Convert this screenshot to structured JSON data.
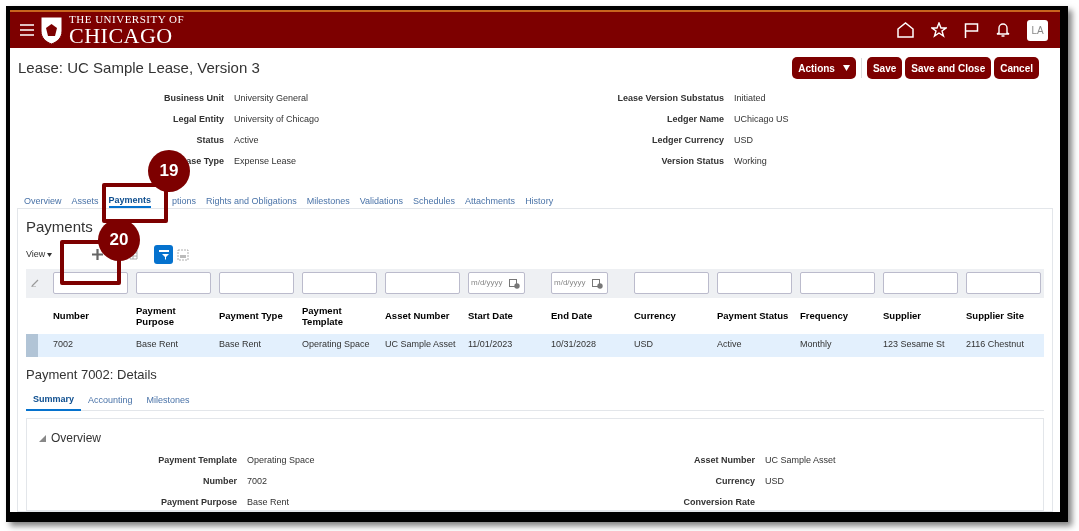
{
  "header": {
    "logo_top": "THE UNIVERSITY OF",
    "logo_bottom": "CHICAGO",
    "avatar": "LA"
  },
  "page_title": "Lease: UC Sample Lease, Version 3",
  "buttons": [
    {
      "label": "Actions",
      "kind": "menu"
    },
    {
      "label": "Save",
      "kind": "plain"
    },
    {
      "label": "Save and Close",
      "kind": "plain"
    },
    {
      "label": "Cancel",
      "kind": "plain"
    }
  ],
  "lease_fields_left": [
    {
      "label": "Business Unit",
      "value": "University General"
    },
    {
      "label": "Legal Entity",
      "value": "University of Chicago"
    },
    {
      "label": "Status",
      "value": "Active"
    },
    {
      "label": "ase Type",
      "value": "Expense Lease"
    }
  ],
  "lease_fields_right": [
    {
      "label": "Lease Version Substatus",
      "value": "Initiated"
    },
    {
      "label": "Ledger Name",
      "value": "UChicago US"
    },
    {
      "label": "Ledger Currency",
      "value": "USD"
    },
    {
      "label": "Version Status",
      "value": "Working"
    }
  ],
  "tabs": [
    {
      "label": "Overview",
      "selected": false
    },
    {
      "label": "Assets",
      "selected": false
    },
    {
      "label": "Payments",
      "selected": true
    },
    {
      "label": "ptions",
      "selected": false
    },
    {
      "label": "Rights and Obligations",
      "selected": false
    },
    {
      "label": "Milestones",
      "selected": false
    },
    {
      "label": "Validations",
      "selected": false
    },
    {
      "label": "Schedules",
      "selected": false
    },
    {
      "label": "Attachments",
      "selected": false
    },
    {
      "label": "History",
      "selected": false
    }
  ],
  "payments": {
    "title": "Payments",
    "view_menu": "View",
    "filters": [
      {
        "kind": "text"
      },
      {
        "kind": "text"
      },
      {
        "kind": "text"
      },
      {
        "kind": "text"
      },
      {
        "kind": "text"
      },
      {
        "kind": "date",
        "placeholder": "m/d/yyyy"
      },
      {
        "kind": "date",
        "placeholder": "m/d/yyyy"
      },
      {
        "kind": "text"
      },
      {
        "kind": "text"
      },
      {
        "kind": "text"
      },
      {
        "kind": "text"
      },
      {
        "kind": "text"
      }
    ],
    "columns": [
      "Number",
      "Payment Purpose",
      "Payment Type",
      "Payment Template",
      "Asset Number",
      "Start Date",
      "End Date",
      "Currency",
      "Payment Status",
      "Frequency",
      "Supplier",
      "Supplier Site"
    ],
    "rows": [
      {
        "selected": true,
        "cells": [
          "7002",
          "Base Rent",
          "Base Rent",
          "Operating Space",
          "UC Sample Asset",
          "11/01/2023",
          "10/31/2028",
          "USD",
          "Active",
          "Monthly",
          "123 Sesame St",
          "2116 Chestnut"
        ]
      }
    ]
  },
  "details": {
    "title": "Payment 7002: Details",
    "tabs": [
      {
        "label": "Summary",
        "selected": true
      },
      {
        "label": "Accounting",
        "selected": false
      },
      {
        "label": "Milestones",
        "selected": false
      }
    ],
    "section": "Overview",
    "expanded": true,
    "fields_left": [
      {
        "label": "Payment Template",
        "value": "Operating Space"
      },
      {
        "label": "Number",
        "value": "7002"
      },
      {
        "label": "Payment Purpose",
        "value": "Base Rent"
      }
    ],
    "fields_right": [
      {
        "label": "Asset Number",
        "value": "UC Sample Asset"
      },
      {
        "label": "Currency",
        "value": "USD"
      },
      {
        "label": "Conversion Rate"
      }
    ]
  },
  "callouts": [
    {
      "number": "19"
    },
    {
      "number": "20"
    }
  ]
}
